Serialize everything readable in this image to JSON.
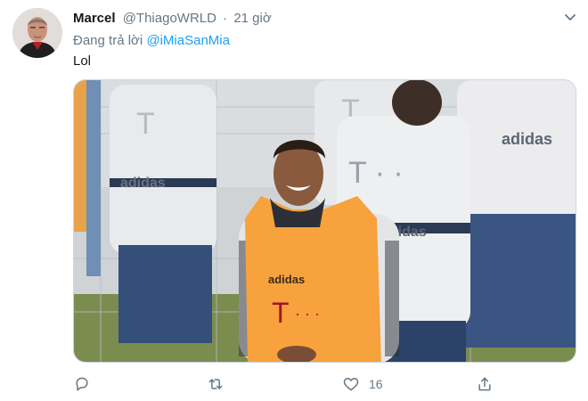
{
  "tweet": {
    "display_name": "Marcel",
    "handle": "@ThiagoWRLD",
    "separator": "·",
    "time": "21 giờ",
    "reply_prefix": "Đang trả lời",
    "reply_to": "@iMiaSanMia",
    "text": "Lol"
  },
  "media": {
    "bib_color": "#f7a23c",
    "shirt_brand": "adidas",
    "sponsor_mark": "T · · ·"
  },
  "actions": {
    "reply_icon": "reply-icon",
    "retweet_icon": "retweet-icon",
    "like_icon": "heart-icon",
    "like_count": "16",
    "share_icon": "share-icon"
  },
  "colors": {
    "link": "#1da1f2",
    "secondary_text": "#657786",
    "primary_text": "#14171a"
  }
}
